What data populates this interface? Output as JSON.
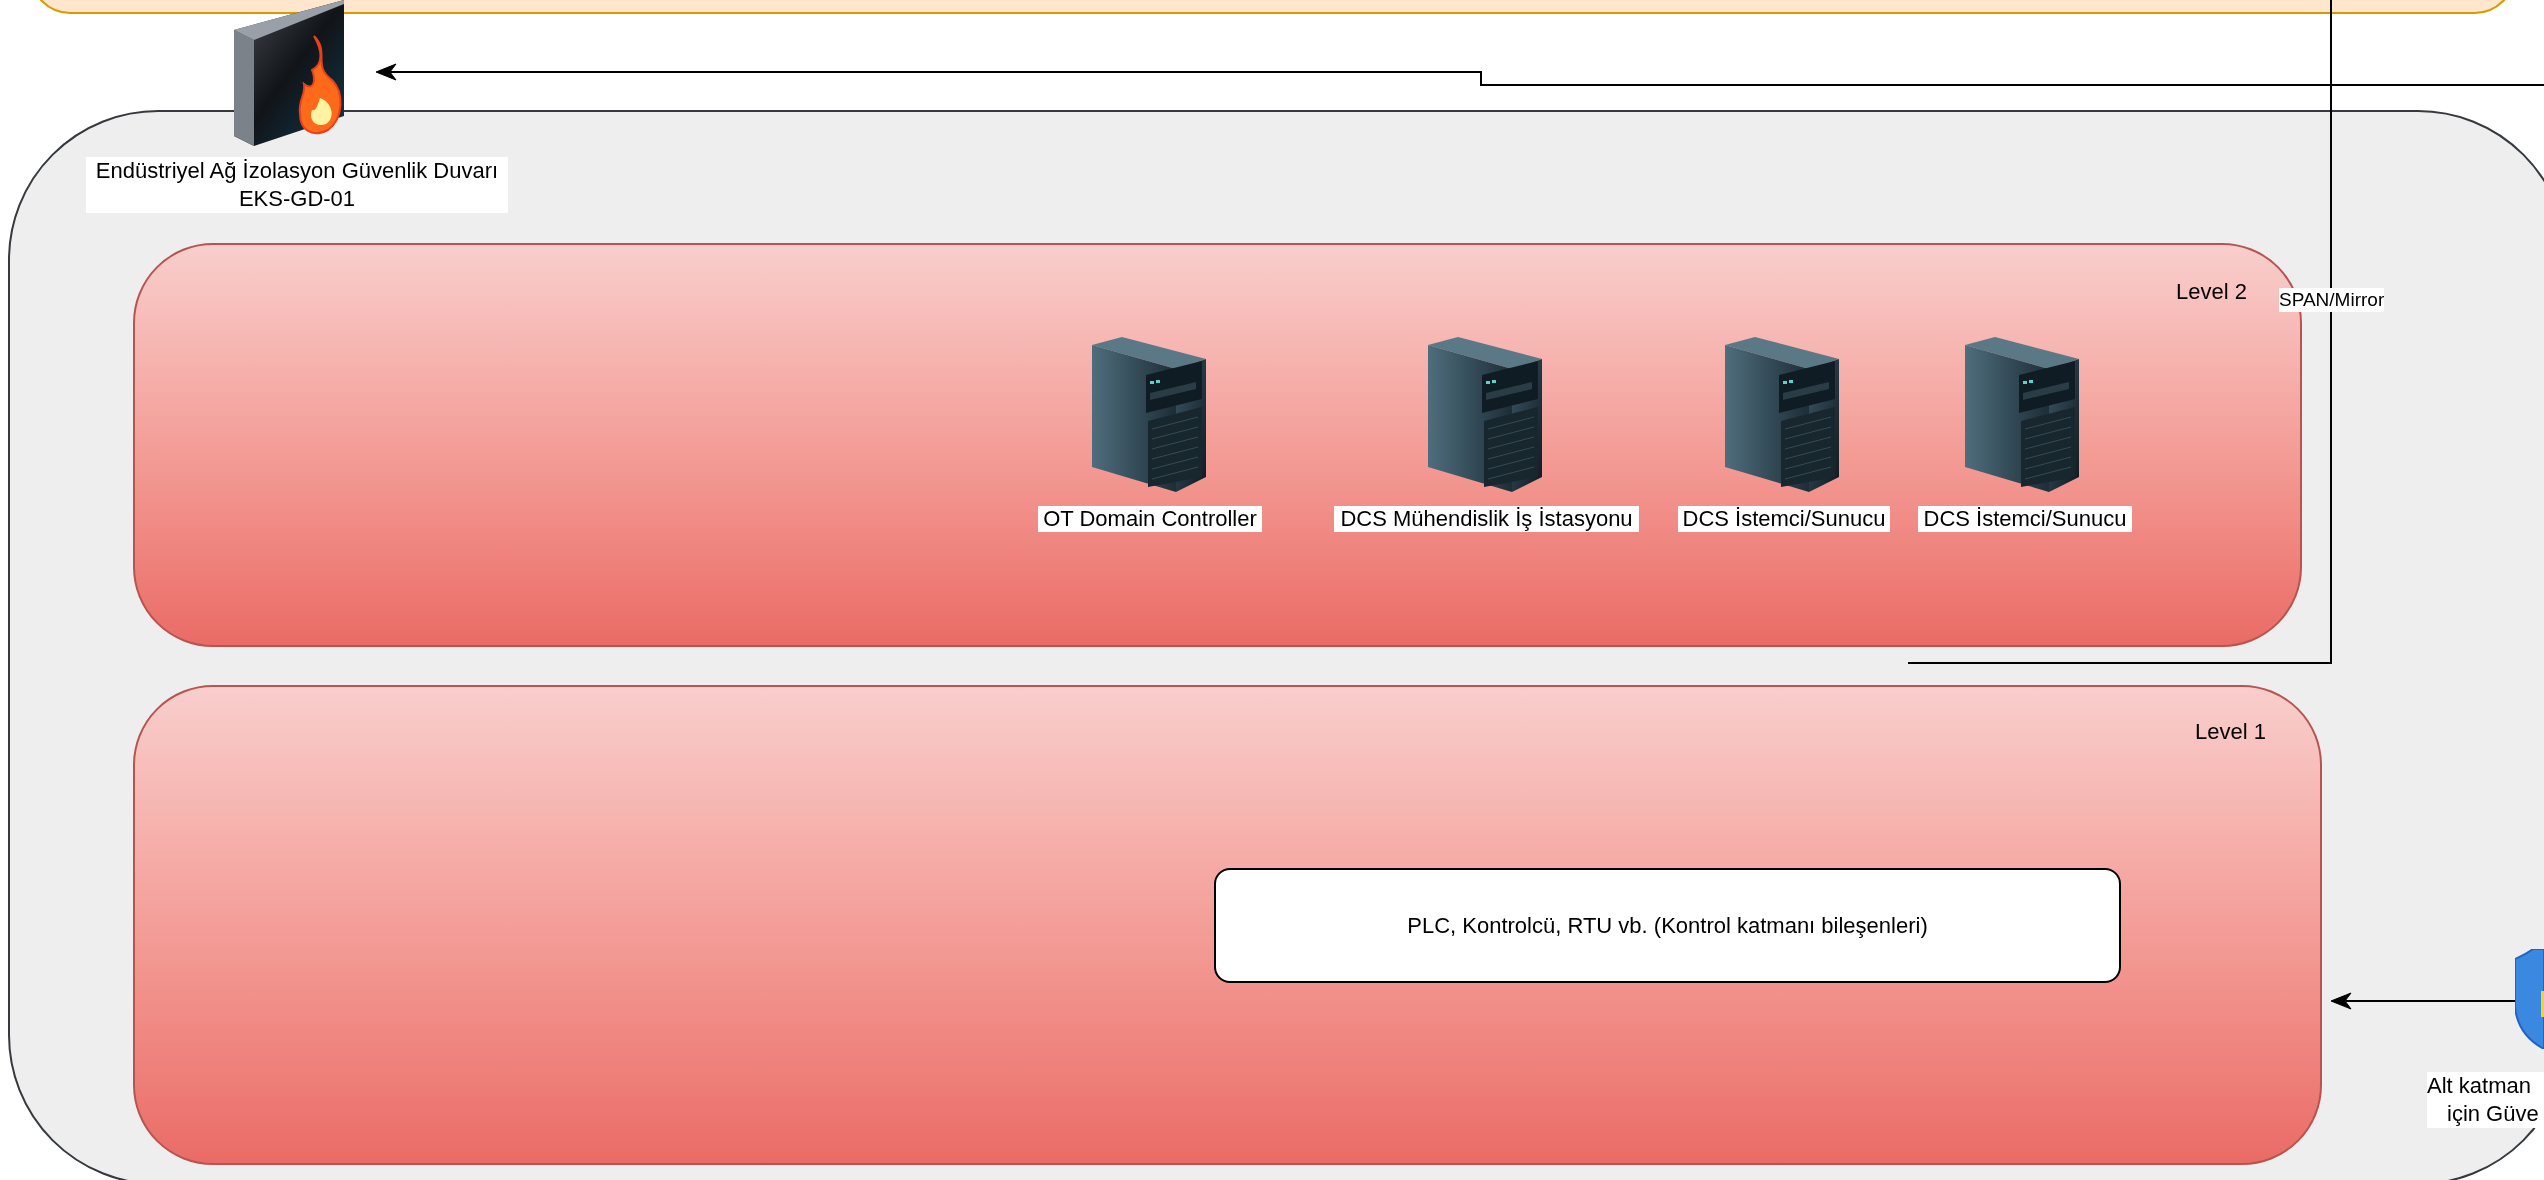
{
  "firewall": {
    "label_lines": [
      "Endüstriyel Ağ İzolasyon Güvenlik Duvarı",
      "EKS-GD-01"
    ]
  },
  "zones": [
    {
      "title": "Level 2",
      "nodes": [
        {
          "kind": "server",
          "label": "OT Domain Controller"
        },
        {
          "kind": "server",
          "label": "DCS Mühendislik İş İstasyonu"
        },
        {
          "kind": "server",
          "label": "DCS İstemci/Sunucu"
        },
        {
          "kind": "server",
          "label": "DCS İstemci/Sunucu"
        }
      ]
    },
    {
      "title": "Level 1",
      "nodes": [
        {
          "kind": "box",
          "label": "PLC, Kontrolcü, RTU vb. (Kontrol katmanı bileşenleri)"
        }
      ]
    }
  ],
  "connectors": [
    {
      "label": "SPAN/Mirror"
    }
  ],
  "shield": {
    "label_lines": [
      "Alt katman",
      "için Güve"
    ]
  }
}
